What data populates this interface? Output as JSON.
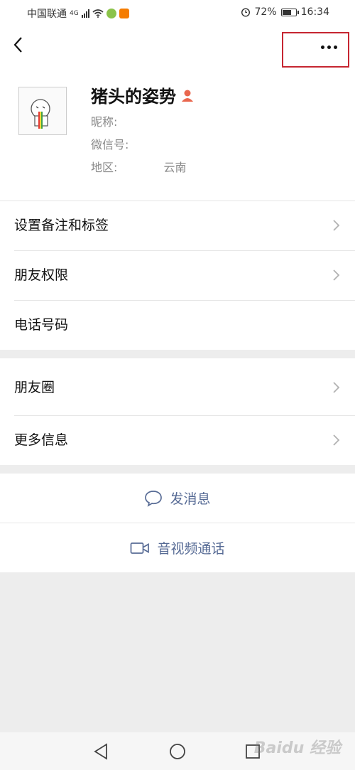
{
  "status_bar": {
    "carrier": "中国联通",
    "network_tag": "4G",
    "battery": "72%",
    "battery_level": 0.72,
    "time": "16:34"
  },
  "profile": {
    "name": "猪头的姿势",
    "nickname_label": "昵称:",
    "wechat_id_label": "微信号:",
    "region_label": "地区:",
    "region_value": "云南"
  },
  "menu_group1": {
    "items": [
      {
        "label": "设置备注和标签"
      },
      {
        "label": "朋友权限"
      },
      {
        "label": "电话号码"
      }
    ]
  },
  "menu_group2": {
    "items": [
      {
        "label": "朋友圈"
      },
      {
        "label": "更多信息"
      }
    ]
  },
  "actions": {
    "message_label": "发消息",
    "video_call_label": "音视频通话"
  },
  "watermark": "Baidu 经验",
  "colors": {
    "accent_link": "#576b95",
    "highlight_box": "#c62631",
    "background": "#ededed"
  },
  "icons": [
    "back-arrow-icon",
    "more-dots-icon",
    "gender-female-icon",
    "chevron-right-icon",
    "chat-bubble-icon",
    "video-camera-icon",
    "nav-back-icon",
    "nav-home-icon",
    "nav-recent-icon"
  ]
}
